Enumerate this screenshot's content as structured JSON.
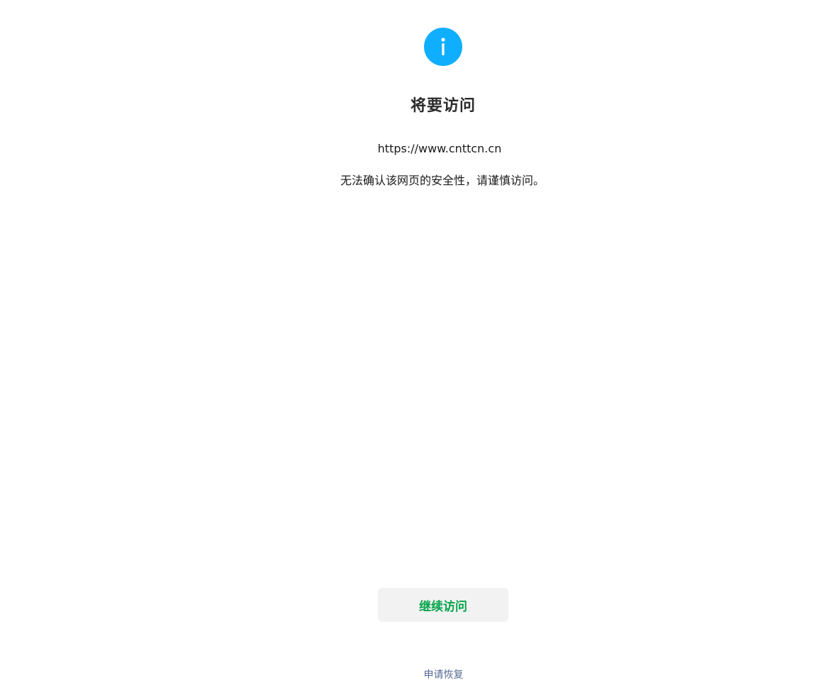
{
  "icon": {
    "name": "info-icon",
    "glyph": "i",
    "color": "#10aeff"
  },
  "title": "将要访问",
  "url": "https://www.cnttcn.cn",
  "warning": "无法确认该网页的安全性，请谨慎访问。",
  "continue_button": {
    "label": "继续访问",
    "text_color": "#07a44b",
    "bg_color": "#f2f2f2"
  },
  "restore_link": {
    "label": "申请恢复",
    "color": "#576b95"
  }
}
